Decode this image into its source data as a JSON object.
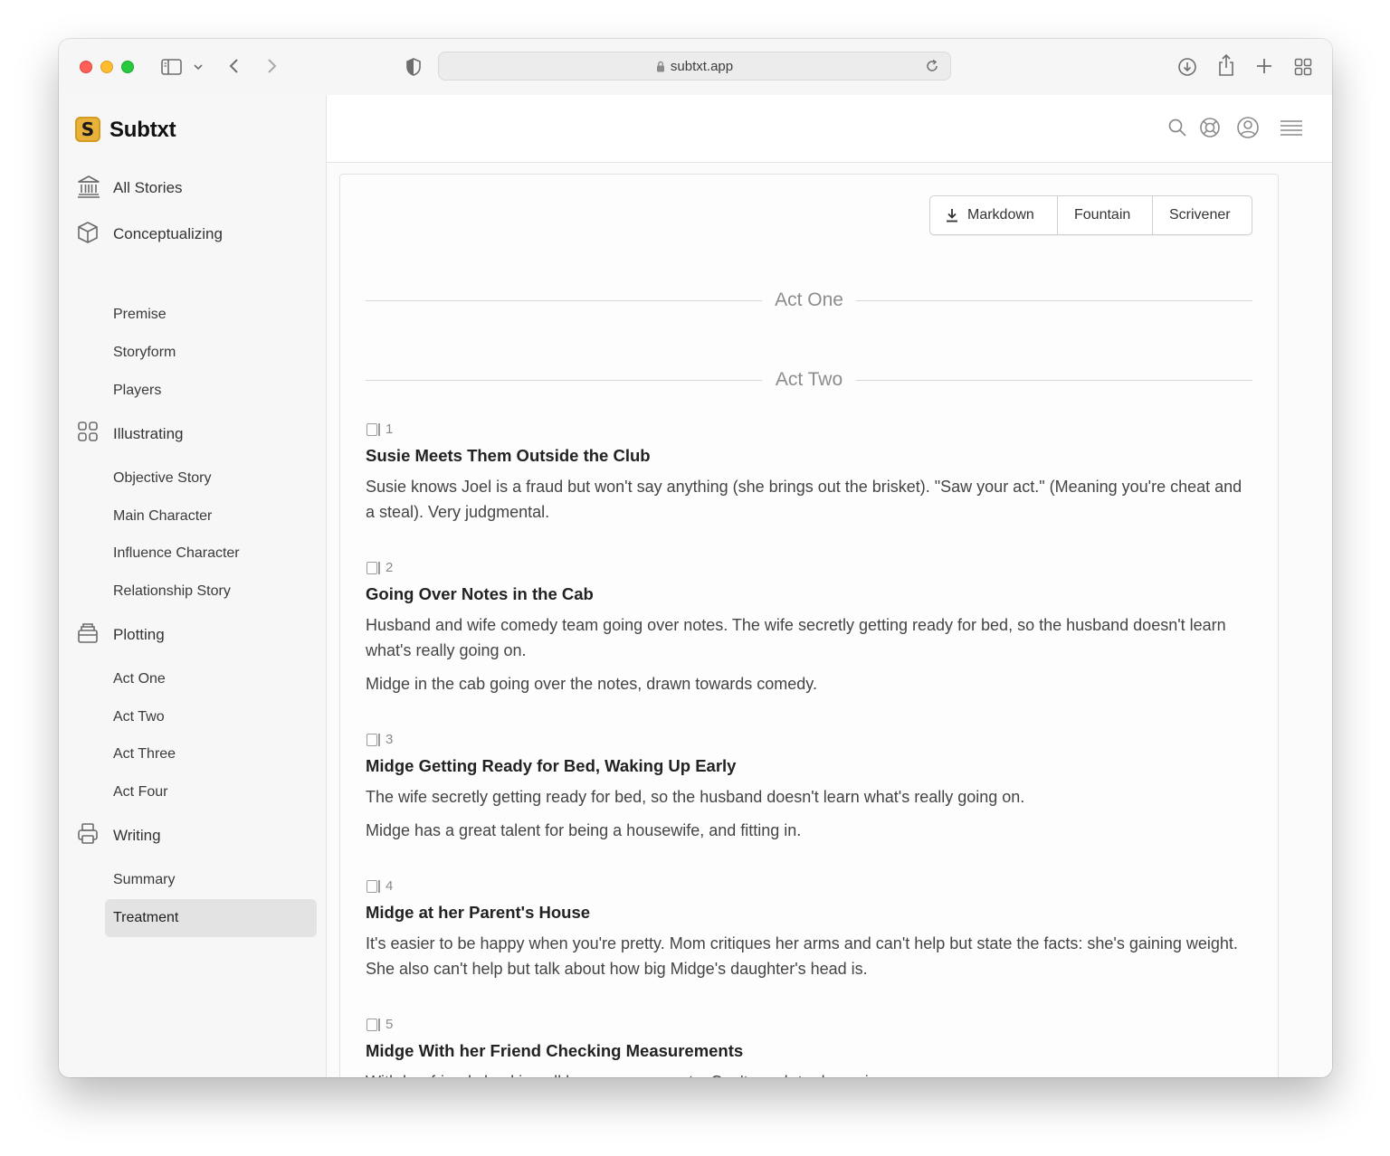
{
  "browser": {
    "url": "subtxt.app"
  },
  "app": {
    "name": "Subtxt",
    "logo_letter": "S"
  },
  "sidebar": {
    "sections": [
      {
        "label": "All Stories",
        "icon": "bank-icon"
      },
      {
        "label": "Conceptualizing",
        "icon": "cube-icon",
        "items": [
          "Premise",
          "Storyform",
          "Players"
        ]
      },
      {
        "label": "Illustrating",
        "icon": "grid-icon",
        "items": [
          "Objective Story",
          "Main Character",
          "Influence Character",
          "Relationship Story"
        ]
      },
      {
        "label": "Plotting",
        "icon": "inbox-icon",
        "items": [
          "Act One",
          "Act Two",
          "Act Three",
          "Act Four"
        ]
      },
      {
        "label": "Writing",
        "icon": "printer-icon",
        "items": [
          "Summary",
          "Treatment"
        ]
      }
    ],
    "active_item": "Treatment"
  },
  "exports": {
    "markdown": "Markdown",
    "fountain": "Fountain",
    "scrivener": "Scrivener"
  },
  "acts": {
    "act_one": "Act One",
    "act_two": "Act Two"
  },
  "scenes": [
    {
      "number": "1",
      "title": "Susie Meets Them Outside the Club",
      "paragraphs": [
        "Susie knows Joel is a fraud but won't say anything (she brings out the brisket). \"Saw your act.\" (Meaning you're cheat and a steal). Very judgmental."
      ]
    },
    {
      "number": "2",
      "title": "Going Over Notes in the Cab",
      "paragraphs": [
        "Husband and wife comedy team going over notes. The wife secretly getting ready for bed, so the husband doesn't learn what's really going on.",
        "Midge in the cab going over the notes, drawn towards comedy."
      ]
    },
    {
      "number": "3",
      "title": "Midge Getting Ready for Bed, Waking Up Early",
      "paragraphs": [
        "The wife secretly getting ready for bed, so the husband doesn't learn what's really going on.",
        "Midge has a great talent for being a housewife, and fitting in."
      ]
    },
    {
      "number": "4",
      "title": "Midge at her Parent's House",
      "paragraphs": [
        "It's easier to be happy when you're pretty. Mom critiques her arms and can't help but state the facts: she's gaining weight. She also can't help but talk about how big Midge's daughter's head is."
      ]
    },
    {
      "number": "5",
      "title": "Midge With her Friend Checking Measurements",
      "paragraphs": [
        "With her friend checking all her measurements. Can't reach to dance in..."
      ]
    }
  ]
}
